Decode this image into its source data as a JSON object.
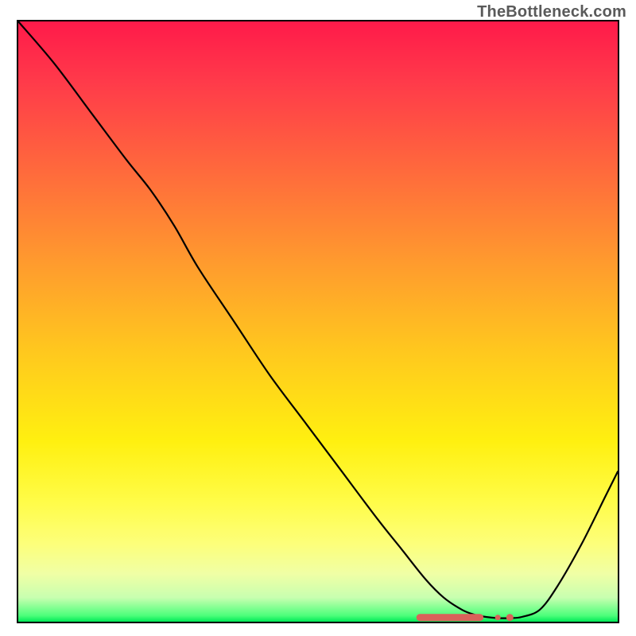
{
  "watermark": "TheBottleneck.com",
  "chart_data": {
    "type": "line",
    "title": "",
    "xlabel": "",
    "ylabel": "",
    "xlim": [
      0,
      100
    ],
    "ylim": [
      0,
      100
    ],
    "series": [
      {
        "name": "bottleneck-curve",
        "x": [
          0,
          6,
          12,
          18,
          22,
          26,
          30,
          36,
          42,
          48,
          54,
          60,
          64,
          68,
          71,
          74,
          76,
          78,
          80,
          82,
          84,
          87,
          90,
          94,
          98,
          100
        ],
        "values": [
          100,
          93,
          85,
          77,
          72,
          66,
          59,
          50,
          41,
          33,
          25,
          17,
          12,
          7,
          4,
          2,
          1.2,
          0.8,
          0.6,
          0.6,
          0.8,
          2,
          6,
          13,
          21,
          25
        ]
      }
    ],
    "markers": {
      "name": "bottom-range-markers",
      "x": [
        67,
        69,
        71,
        73,
        75,
        77,
        80,
        82
      ],
      "y": [
        0.7,
        0.7,
        0.7,
        0.7,
        0.7,
        0.7,
        0.7,
        0.7
      ],
      "color": "#d9625a"
    },
    "background_gradient": {
      "top": "#ff1a4a",
      "mid": "#fff010",
      "bottom": "#00e858"
    }
  }
}
